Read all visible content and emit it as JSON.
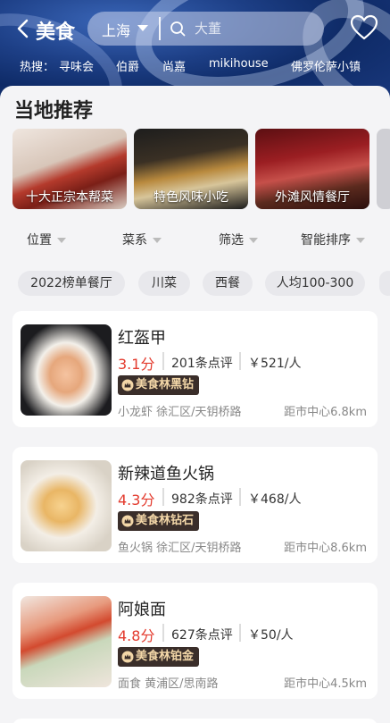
{
  "header": {
    "title": "美食",
    "city": "上海",
    "search_placeholder": "大董",
    "hot_label": "热搜：",
    "hot_items": [
      "寻味会",
      "伯爵",
      "尚嘉",
      "mikihouse",
      "佛罗伦萨小镇"
    ]
  },
  "section_title": "当地推荐",
  "recommendations": [
    "十大正宗本帮菜",
    "特色风味小吃",
    "外滩风情餐厅"
  ],
  "filters": [
    "位置",
    "菜系",
    "筛选",
    "智能排序"
  ],
  "chips": [
    "2022榜单餐厅",
    "川菜",
    "西餐",
    "人均100-300"
  ],
  "restaurants": [
    {
      "name": "红盔甲",
      "score": "3.1分",
      "reviews": "201条点评",
      "price": "￥521/人",
      "badge": "美食林黑钻",
      "location": "小龙虾 徐汇区/天钥桥路",
      "distance": "距市中心6.8km"
    },
    {
      "name": "新辣道鱼火锅",
      "score": "4.3分",
      "reviews": "982条点评",
      "price": "￥468/人",
      "badge": "美食林钻石",
      "location": "鱼火锅 徐汇区/天钥桥路",
      "distance": "距市中心8.6km"
    },
    {
      "name": "阿娘面",
      "score": "4.8分",
      "reviews": "627条点评",
      "price": "￥50/人",
      "badge": "美食林铂金",
      "location": "面食 黄浦区/思南路",
      "distance": "距市中心4.5km"
    }
  ],
  "icons": {
    "back": "back-arrow-icon",
    "caret": "caret-down-icon",
    "search": "search-icon",
    "favorite": "heart-icon",
    "badge": "crown-icon"
  },
  "colors": {
    "header_blue": "#1d3f86",
    "score_red": "#e33a2d",
    "badge_bg": "#3a2e2a",
    "badge_text": "#f3d7a8"
  }
}
